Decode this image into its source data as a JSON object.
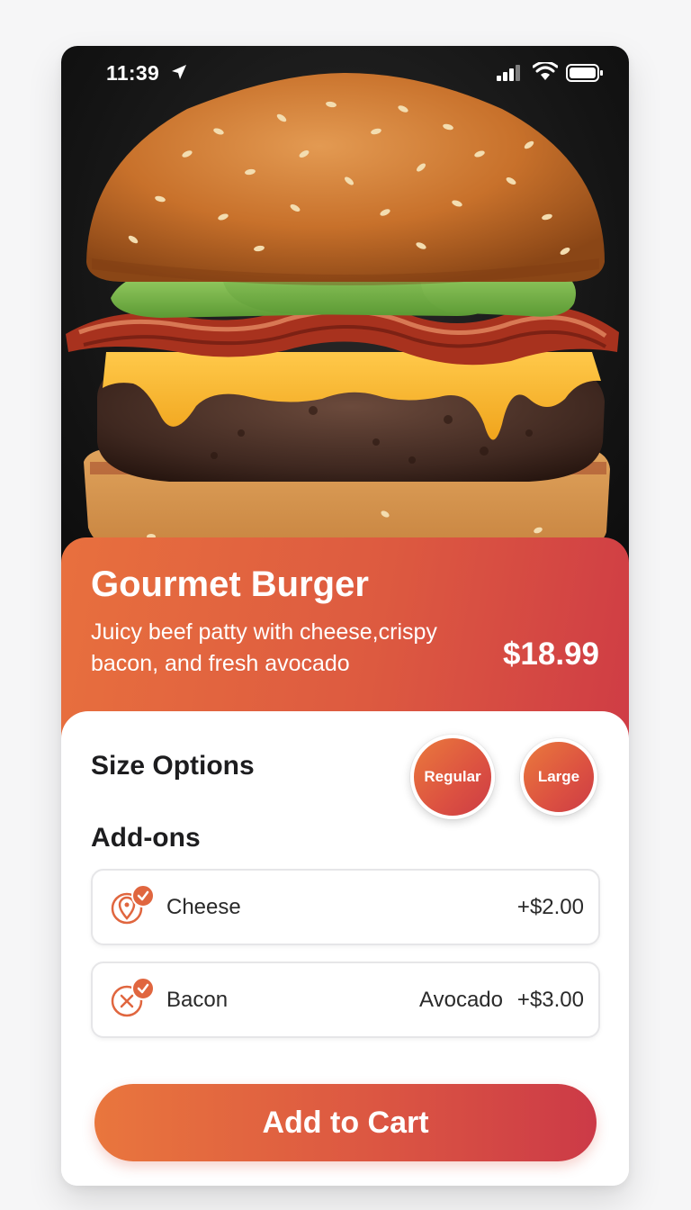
{
  "status_bar": {
    "time": "11:39"
  },
  "product": {
    "title": "Gourmet Burger",
    "description": "Juicy beef patty with cheese,crispy bacon, and fresh avocado",
    "price": "$18.99"
  },
  "size_options": {
    "title": "Size Options",
    "options": [
      {
        "label": "Regular"
      },
      {
        "label": "Large"
      }
    ]
  },
  "addons": {
    "title": "Add-ons",
    "items": [
      {
        "name": "Cheese",
        "extra": "",
        "price": "+$2.00",
        "icon": "location-pin-icon",
        "checked": true
      },
      {
        "name": "Bacon",
        "extra": "Avocado",
        "price": "+$3.00",
        "icon": "close-circle-icon",
        "checked": true
      }
    ]
  },
  "cart": {
    "label": "Add to Cart"
  },
  "colors": {
    "accent_start": "#e9763d",
    "accent_end": "#cc3a47",
    "background": "#f6f6f7"
  }
}
